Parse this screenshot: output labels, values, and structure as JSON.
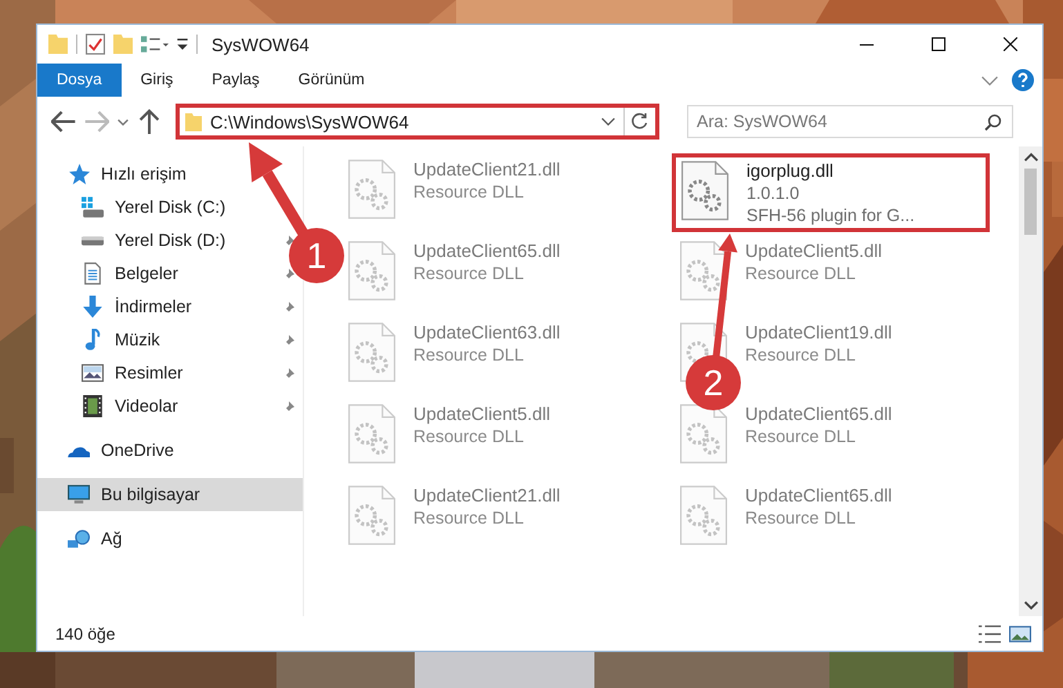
{
  "window": {
    "title": "SysWOW64"
  },
  "ribbon_tabs": [
    {
      "label": "Dosya",
      "selected": true
    },
    {
      "label": "Giriş",
      "selected": false
    },
    {
      "label": "Paylaş",
      "selected": false
    },
    {
      "label": "Görünüm",
      "selected": false
    }
  ],
  "address_bar": {
    "path": "C:\\Windows\\SysWOW64",
    "highlighted": true
  },
  "search": {
    "placeholder": "Ara: SysWOW64"
  },
  "nav": [
    {
      "label": "Hızlı erişim",
      "kind": "star",
      "selected": false,
      "children": [
        {
          "label": "Yerel Disk (C:)",
          "kind": "drive-windows",
          "pinned": false
        },
        {
          "label": "Yerel Disk (D:)",
          "kind": "drive",
          "pinned": true
        },
        {
          "label": "Belgeler",
          "kind": "document",
          "pinned": true
        },
        {
          "label": "İndirmeler",
          "kind": "download",
          "pinned": true
        },
        {
          "label": "Müzik",
          "kind": "music",
          "pinned": true
        },
        {
          "label": "Resimler",
          "kind": "pictures",
          "pinned": true
        },
        {
          "label": "Videolar",
          "kind": "video",
          "pinned": true
        }
      ]
    },
    {
      "label": "OneDrive",
      "kind": "cloud",
      "selected": false
    },
    {
      "label": "Bu bilgisayar",
      "kind": "computer",
      "selected": true
    },
    {
      "label": "Ağ",
      "kind": "network",
      "selected": false
    }
  ],
  "files": [
    {
      "name": "UpdateClient21.dll",
      "description": "Resource DLL",
      "highlighted": false
    },
    {
      "name": "igorplug.dll",
      "version": "1.0.1.0",
      "description": "SFH-56 plugin for G...",
      "highlighted": true
    },
    {
      "name": "UpdateClient65.dll",
      "description": "Resource DLL",
      "highlighted": false
    },
    {
      "name": "UpdateClient5.dll",
      "description": "Resource DLL",
      "highlighted": false
    },
    {
      "name": "UpdateClient63.dll",
      "description": "Resource DLL",
      "highlighted": false
    },
    {
      "name": "UpdateClient19.dll",
      "description": "Resource DLL",
      "highlighted": false
    },
    {
      "name": "UpdateClient5.dll",
      "description": "Resource DLL",
      "highlighted": false
    },
    {
      "name": "UpdateClient65.dll",
      "description": "Resource DLL",
      "highlighted": false
    },
    {
      "name": "UpdateClient21.dll",
      "description": "Resource DLL",
      "highlighted": false
    },
    {
      "name": "UpdateClient65.dll",
      "description": "Resource DLL",
      "highlighted": false
    }
  ],
  "status_bar": {
    "item_count": "140 öğe"
  },
  "annotations": [
    {
      "number": "1"
    },
    {
      "number": "2"
    }
  ]
}
